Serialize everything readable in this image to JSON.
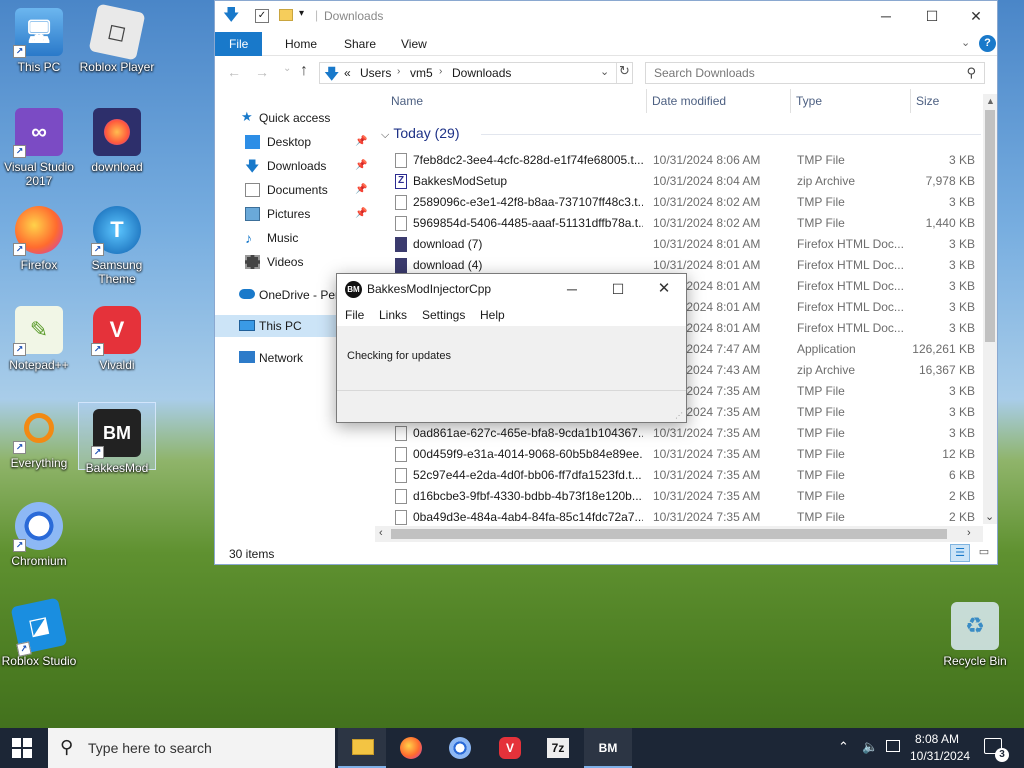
{
  "desktop": {
    "icons": [
      {
        "label": "This PC",
        "icon": "computer-icon"
      },
      {
        "label": "Roblox Player",
        "icon": "roblox-icon"
      },
      {
        "label": "Visual Studio 2017",
        "icon": "visual-studio-icon"
      },
      {
        "label": "download",
        "icon": "firefox-html-icon"
      },
      {
        "label": "Firefox",
        "icon": "firefox-icon"
      },
      {
        "label": "Samsung Theme",
        "icon": "samsung-theme-icon"
      },
      {
        "label": "Notepad++",
        "icon": "notepadpp-icon"
      },
      {
        "label": "Vivaldi",
        "icon": "vivaldi-icon"
      },
      {
        "label": "Everything",
        "icon": "everything-search-icon"
      },
      {
        "label": "BakkesMod",
        "icon": "bakkesmod-icon"
      },
      {
        "label": "Chromium",
        "icon": "chromium-icon"
      },
      {
        "label": "Roblox Studio",
        "icon": "roblox-studio-icon"
      },
      {
        "label": "Recycle Bin",
        "icon": "recycle-bin-icon"
      }
    ]
  },
  "explorer": {
    "title": "Downloads",
    "ribbon_tabs": [
      "File",
      "Home",
      "Share",
      "View"
    ],
    "address": {
      "chevron": "«",
      "parts": [
        "Users",
        "vm5",
        "Downloads"
      ]
    },
    "search_placeholder": "Search Downloads",
    "nav": {
      "quick_access": "Quick access",
      "pinned": [
        "Desktop",
        "Downloads",
        "Documents",
        "Pictures"
      ],
      "others": [
        "Music",
        "Videos"
      ],
      "onedrive": "OneDrive - Per",
      "this_pc": "This PC",
      "network": "Network"
    },
    "columns": {
      "name": "Name",
      "date": "Date modified",
      "type": "Type",
      "size": "Size"
    },
    "group_label": "Today (29)",
    "files": [
      {
        "name": "7feb8dc2-3ee4-4cfc-828d-e1f74fe68005.t...",
        "date": "10/31/2024 8:06 AM",
        "type": "TMP File",
        "size": "3 KB",
        "kind": "tmp"
      },
      {
        "name": "BakkesModSetup",
        "date": "10/31/2024 8:04 AM",
        "type": "zip Archive",
        "size": "7,978 KB",
        "kind": "zip"
      },
      {
        "name": "2589096c-e3e1-42f8-b8aa-737107ff48c3.t...",
        "date": "10/31/2024 8:02 AM",
        "type": "TMP File",
        "size": "3 KB",
        "kind": "tmp"
      },
      {
        "name": "5969854d-5406-4485-aaaf-51131dffb78a.t...",
        "date": "10/31/2024 8:02 AM",
        "type": "TMP File",
        "size": "1,440 KB",
        "kind": "tmp"
      },
      {
        "name": "download (7)",
        "date": "10/31/2024 8:01 AM",
        "type": "Firefox HTML Doc...",
        "size": "3 KB",
        "kind": "ff"
      },
      {
        "name": "download (4)",
        "date": "10/31/2024 8:01 AM",
        "type": "Firefox HTML Doc...",
        "size": "3 KB",
        "kind": "ff"
      },
      {
        "name": "",
        "date": "10/31/2024 8:01 AM",
        "type": "Firefox HTML Doc...",
        "size": "3 KB",
        "kind": "ff"
      },
      {
        "name": "",
        "date": "10/31/2024 8:01 AM",
        "type": "Firefox HTML Doc...",
        "size": "3 KB",
        "kind": "ff"
      },
      {
        "name": "",
        "date": "10/31/2024 8:01 AM",
        "type": "Firefox HTML Doc...",
        "size": "3 KB",
        "kind": "ff"
      },
      {
        "name": "",
        "date": "10/31/2024 7:47 AM",
        "type": "Application",
        "size": "126,261 KB",
        "kind": "app"
      },
      {
        "name": "",
        "date": "10/31/2024 7:43 AM",
        "type": "zip Archive",
        "size": "16,367 KB",
        "kind": "zip"
      },
      {
        "name": "",
        "date": "10/31/2024 7:35 AM",
        "type": "TMP File",
        "size": "3 KB",
        "kind": "tmp"
      },
      {
        "name": "",
        "date": "10/31/2024 7:35 AM",
        "type": "TMP File",
        "size": "3 KB",
        "kind": "tmp"
      },
      {
        "name": "0ad861ae-627c-465e-bfa8-9cda1b104367....",
        "date": "10/31/2024 7:35 AM",
        "type": "TMP File",
        "size": "3 KB",
        "kind": "tmp"
      },
      {
        "name": "00d459f9-e31a-4014-9068-60b5b84e89ee....",
        "date": "10/31/2024 7:35 AM",
        "type": "TMP File",
        "size": "12 KB",
        "kind": "tmp"
      },
      {
        "name": "52c97e44-e2da-4d0f-bb06-ff7dfa1523fd.t...",
        "date": "10/31/2024 7:35 AM",
        "type": "TMP File",
        "size": "6 KB",
        "kind": "tmp"
      },
      {
        "name": "d16bcbe3-9fbf-4330-bdbb-4b73f18e120b....",
        "date": "10/31/2024 7:35 AM",
        "type": "TMP File",
        "size": "2 KB",
        "kind": "tmp"
      },
      {
        "name": "0ba49d3e-484a-4ab4-84fa-85c14fdc72a7....",
        "date": "10/31/2024 7:35 AM",
        "type": "TMP File",
        "size": "2 KB",
        "kind": "tmp"
      }
    ],
    "status": "30 items"
  },
  "injector": {
    "title": "BakkesModInjectorCpp",
    "logo": "BM",
    "menu": [
      "File",
      "Links",
      "Settings",
      "Help"
    ],
    "message": "Checking for updates"
  },
  "taskbar": {
    "search_placeholder": "Type here to search",
    "apps": [
      "file-explorer-icon",
      "firefox-icon",
      "chromium-icon",
      "vivaldi-icon",
      "7zip-icon",
      "bakkesmod-icon"
    ],
    "seven_zip_label": "7z",
    "time": "8:08 AM",
    "date": "10/31/2024",
    "notification_count": "3"
  },
  "colors": {
    "accent": "#1979ca",
    "selection": "#cce4f7",
    "taskbar": "#1c2636"
  }
}
